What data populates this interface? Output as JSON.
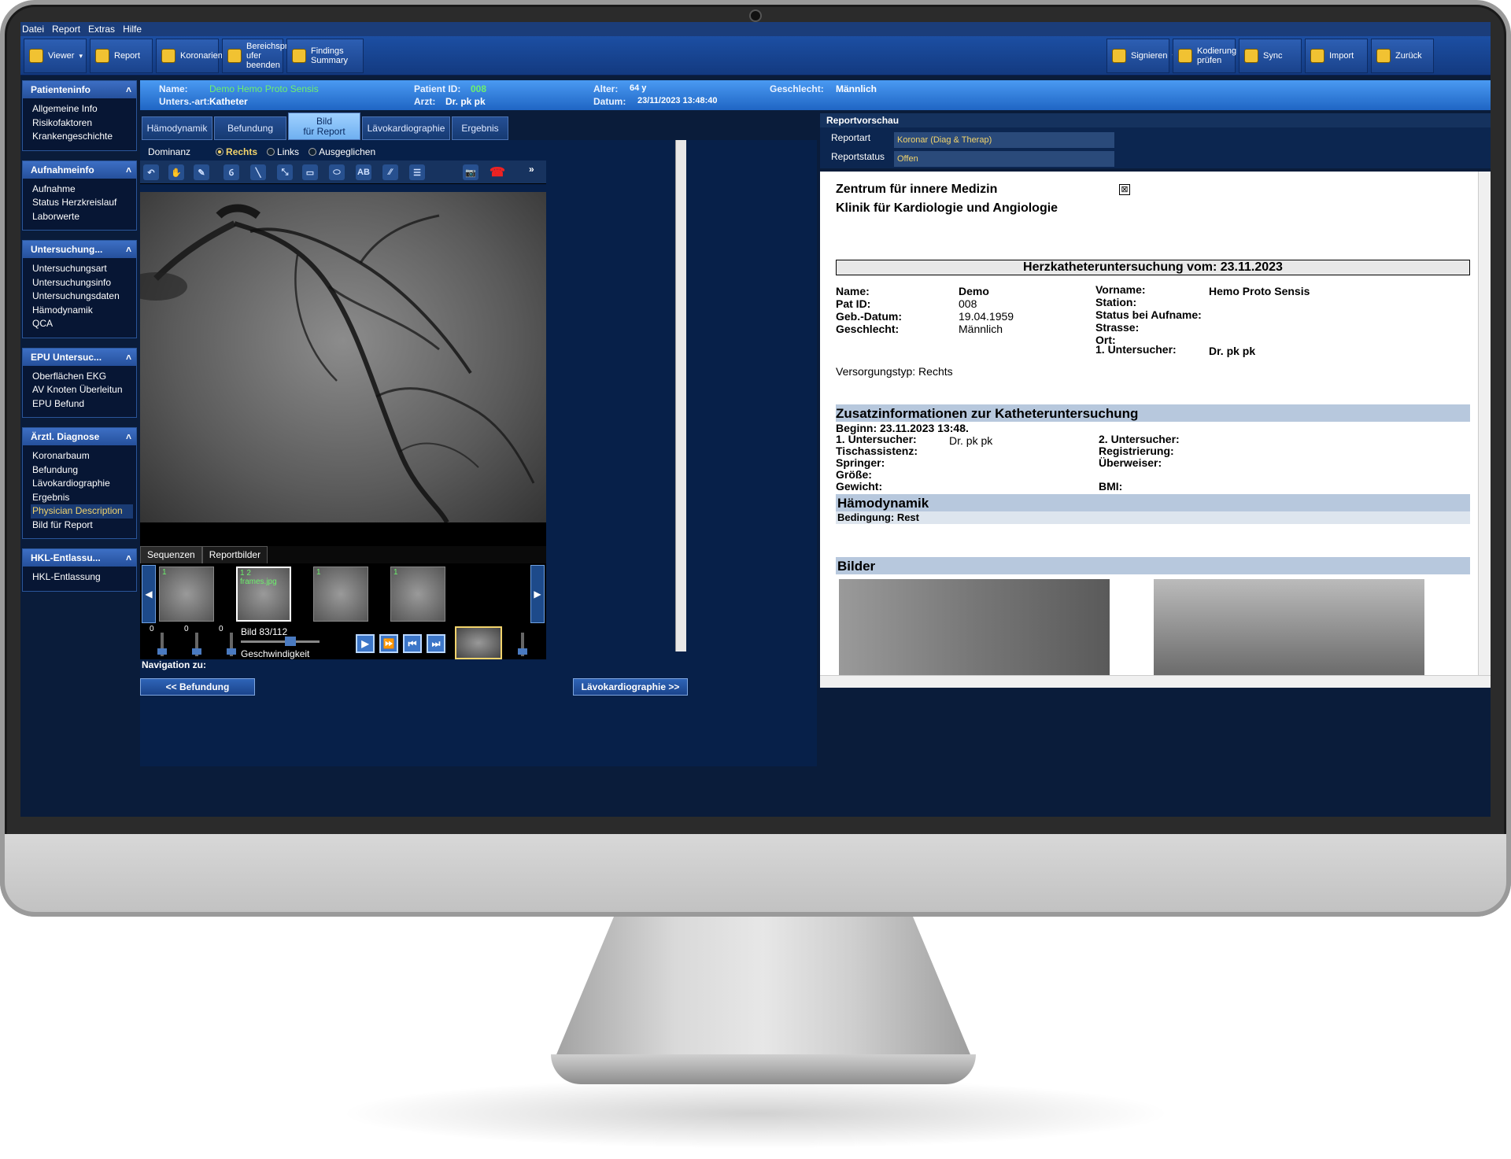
{
  "menu": [
    "Datei",
    "Report",
    "Extras",
    "Hilfe"
  ],
  "toolbar": {
    "left": [
      {
        "label": "Viewer",
        "icon": "viewer-icon",
        "dropdown": true
      },
      {
        "label": "Report",
        "icon": "report-icon",
        "dropdown": false
      },
      {
        "label": "Koronarien",
        "icon": "coronary-icon",
        "dropdown": false
      },
      {
        "label": "Bereichspr\nufer\nbeenden",
        "icon": "warning-icon",
        "dropdown": true
      },
      {
        "label": "Findings\nSummary",
        "icon": "findings-icon",
        "dropdown": false
      }
    ],
    "right": [
      {
        "label": "Signieren",
        "icon": "sign-icon",
        "dropdown": true
      },
      {
        "label": "Kodierung\nprüfen",
        "icon": "coding-icon",
        "dropdown": false
      },
      {
        "label": "Sync",
        "icon": "sync-icon",
        "dropdown": false
      },
      {
        "label": "Import",
        "icon": "import-icon",
        "dropdown": false
      },
      {
        "label": "Zurück",
        "icon": "back-icon",
        "dropdown": false
      }
    ]
  },
  "sidebar": [
    {
      "title": "Patienteninfo",
      "items": [
        "Allgemeine Info",
        "Risikofaktoren",
        "Krankengeschichte"
      ]
    },
    {
      "title": "Aufnahmeinfo",
      "items": [
        "Aufnahme",
        "Status Herzkreislauf",
        "Laborwerte"
      ]
    },
    {
      "title": "Untersuchung...",
      "items": [
        "Untersuchungsart",
        "Untersuchungsinfo",
        "Untersuchungsdaten",
        "Hämodynamik",
        "QCA"
      ]
    },
    {
      "title": "EPU Untersuc...",
      "items": [
        "Oberflächen EKG",
        "AV Knoten Überleitun",
        "EPU Befund"
      ]
    },
    {
      "title": "Ärztl. Diagnose",
      "items": [
        "Koronarbaum",
        "Befundung",
        "Lävokardiographie",
        "Ergebnis",
        "Physician Description",
        "Bild für Report"
      ],
      "selected": "Physician Description"
    },
    {
      "title": "HKL-Entlassu...",
      "items": [
        "HKL-Entlassung"
      ]
    }
  ],
  "patient": {
    "name_label": "Name:",
    "name": "Demo Hemo Proto Sensis",
    "unters_label": "Unters.-art:",
    "unters": "Katheter",
    "pid_label": "Patient ID:",
    "pid": "008",
    "arzt_label": "Arzt:",
    "arzt": "Dr. pk pk",
    "alter_label": "Alter:",
    "alter": "64 y",
    "datum_label": "Datum:",
    "datum": "23/11/2023 13:48:40",
    "geschlecht_label": "Geschlecht:",
    "geschlecht": "Männlich"
  },
  "tabs": [
    "Hämodynamik",
    "Befundung",
    "Bild\nfür Report",
    "Lävokardiographie",
    "Ergebnis"
  ],
  "active_tab": "Bild\nfür Report",
  "dominanz": {
    "label": "Dominanz",
    "options": [
      "Rechts",
      "Links",
      "Ausgeglichen"
    ],
    "selected": "Rechts"
  },
  "image_tools": [
    "↶",
    "✋",
    "✎",
    "Ⳓ",
    "╲",
    "⤡",
    "▭",
    "⬭",
    "AB",
    "∕∕",
    "☰",
    "📷",
    "☎"
  ],
  "sequence_tabs": [
    "Sequenzen",
    "Reportbilder"
  ],
  "thumbs": [
    "1",
    "1  2 frames.jpg",
    "1",
    "1"
  ],
  "playback": {
    "frame": "Bild 83/112",
    "speed_label": "Geschwindigkeit",
    "slider_values": [
      "0",
      "0",
      "0"
    ]
  },
  "navigation": {
    "label": "Navigation zu:",
    "prev": "<< Befundung",
    "next": "Lävokardiographie >>"
  },
  "report_preview": {
    "title": "Reportvorschau",
    "reportart_label": "Reportart",
    "reportart": "Koronar (Diag & Therap)",
    "reportstatus_label": "Reportstatus",
    "reportstatus": "Offen",
    "clinic1": "Zentrum für innere Medizin",
    "clinic2": "Klinik für Kardiologie und Angiologie",
    "heading": "Herzkatheteruntersuchung vom: 23.11.2023",
    "fields_left": [
      [
        "Name:",
        "Demo"
      ],
      [
        "Pat ID:",
        "008"
      ],
      [
        "Geb.-Datum:",
        "19.04.1959"
      ],
      [
        "Geschlecht:",
        "Männlich"
      ]
    ],
    "fields_right": [
      [
        "Vorname:",
        "Hemo Proto Sensis"
      ],
      [
        "Station:",
        ""
      ],
      [
        "Status bei Aufname:",
        ""
      ],
      [
        "Strasse:",
        ""
      ],
      [
        "Ort:",
        ""
      ],
      [
        "1. Untersucher:",
        "Dr. pk pk"
      ]
    ],
    "versorgung": "Versorgungstyp: Rechts",
    "zusatz_title": "Zusatzinformationen zur Katheteruntersuchung",
    "beginn": "Beginn: 23.11.2023 13:48.",
    "zusatz_left": [
      [
        "1. Untersucher:",
        "Dr. pk pk"
      ],
      [
        "Tischassistenz:",
        ""
      ],
      [
        "Springer:",
        ""
      ],
      [
        "Größe:",
        ""
      ],
      [
        "Gewicht:",
        ""
      ]
    ],
    "zusatz_right": [
      [
        "2. Untersucher:",
        ""
      ],
      [
        "Registrierung:",
        ""
      ],
      [
        "Überweiser:",
        ""
      ],
      [
        "",
        ""
      ],
      [
        "BMI:",
        ""
      ]
    ],
    "haemo_title": "Hämodynamik",
    "bedingung": "Bedingung: Rest",
    "bilder_title": "Bilder"
  },
  "colors": {
    "accent": "#2a5fb8",
    "selected_text": "#f2d36b",
    "patient_name": "#6df06d"
  }
}
